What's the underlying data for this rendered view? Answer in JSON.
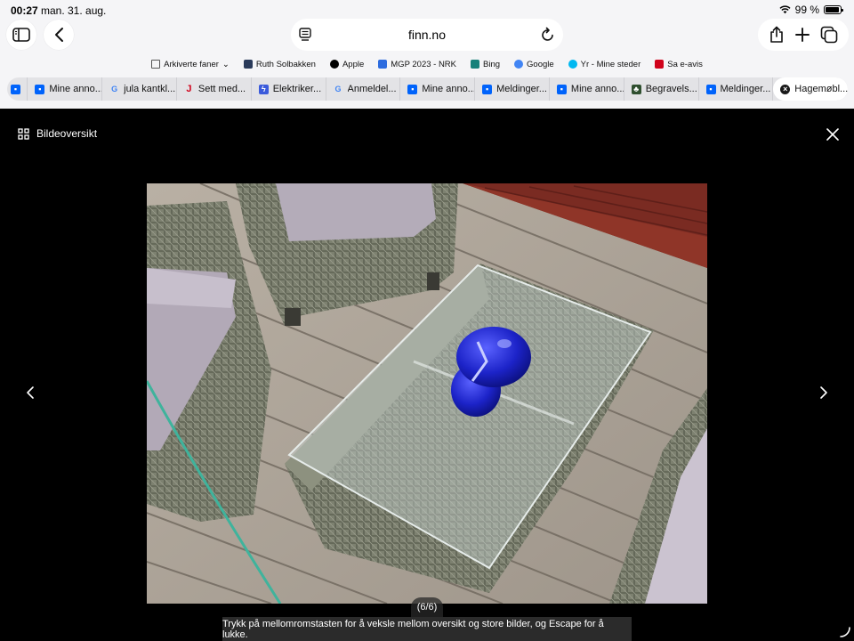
{
  "status_bar": {
    "time": "00:27",
    "date": "man. 31. aug.",
    "battery": "99 %"
  },
  "browser": {
    "url": "finn.no",
    "bookmarks": [
      {
        "label": "Arkiverte faner",
        "icon": "folder-icon",
        "color": "#555555"
      },
      {
        "label": "Ruth Solbakken",
        "icon": "grid-icon",
        "color": "#2a3a5a"
      },
      {
        "label": "Apple",
        "icon": "apple-icon",
        "color": "#000000"
      },
      {
        "label": "MGP 2023 - NRK",
        "icon": "nrk-icon",
        "color": "#2d6cdf"
      },
      {
        "label": "Bing",
        "icon": "bing-icon",
        "color": "#16817a"
      },
      {
        "label": "Google",
        "icon": "google-icon",
        "color": "#4285f4"
      },
      {
        "label": "Yr - Mine steder",
        "icon": "yr-icon",
        "color": "#00b8f1"
      },
      {
        "label": "Sa e-avis",
        "icon": "sa-icon",
        "color": "#d0021b"
      }
    ],
    "tabs": [
      {
        "label": "",
        "icon": "finn-icon",
        "color": "#0063fb"
      },
      {
        "label": "Mine anno...",
        "icon": "finn-icon",
        "color": "#0063fb"
      },
      {
        "label": "jula kantkl...",
        "icon": "google-icon",
        "color": "#4285f4"
      },
      {
        "label": "Sett med...",
        "icon": "j-icon",
        "color": "#d0021b"
      },
      {
        "label": "Elektriker...",
        "icon": "bolt-icon",
        "color": "#3b5bdb"
      },
      {
        "label": "Anmeldel...",
        "icon": "google-icon",
        "color": "#4285f4"
      },
      {
        "label": "Mine anno...",
        "icon": "finn-icon",
        "color": "#0063fb"
      },
      {
        "label": "Meldinger...",
        "icon": "finn-icon",
        "color": "#0063fb"
      },
      {
        "label": "Mine anno...",
        "icon": "finn-icon",
        "color": "#0063fb"
      },
      {
        "label": "Begravels...",
        "icon": "tree-icon",
        "color": "#2f4f2f"
      },
      {
        "label": "Meldinger...",
        "icon": "finn-icon",
        "color": "#0063fb"
      },
      {
        "label": "Hagemøbl...",
        "icon": "close-circle-icon",
        "color": "#1a1a1a",
        "active": true
      }
    ]
  },
  "lightbox": {
    "overview_label": "Bildeoversikt",
    "counter": "(6/6)",
    "hint": "Trykk på mellomromstasten for å veksle mellom oversikt og store bilder, og Escape for å lukke."
  }
}
